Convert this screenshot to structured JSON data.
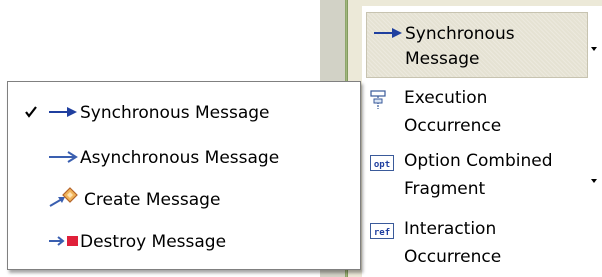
{
  "popup_menu": {
    "items": [
      {
        "label": "Synchronous Message",
        "icon": "sync-arrow-icon",
        "checked": true
      },
      {
        "label": "Asynchronous Message",
        "icon": "async-arrow-icon",
        "checked": false
      },
      {
        "label": "Create Message",
        "icon": "create-message-icon",
        "checked": false
      },
      {
        "label": "Destroy Message",
        "icon": "destroy-message-icon",
        "checked": false
      }
    ]
  },
  "palette": {
    "drawer": {
      "line1": "Synchronous",
      "line2": "Message"
    },
    "items": [
      {
        "line1": "Execution",
        "line2": "Occurrence",
        "icon": "execution-occurrence-icon"
      },
      {
        "line1": "Option Combined",
        "line2": "Fragment",
        "icon": "option-combined-fragment-icon",
        "icon_text": "opt"
      },
      {
        "line1": "Interaction",
        "line2": "Occurrence",
        "icon": "interaction-occurrence-icon",
        "icon_text": "ref"
      }
    ]
  },
  "colors": {
    "arrow_blue": "#1f3f9f",
    "destroy_red": "#e0203a",
    "create_orange": "#d97a2a"
  }
}
